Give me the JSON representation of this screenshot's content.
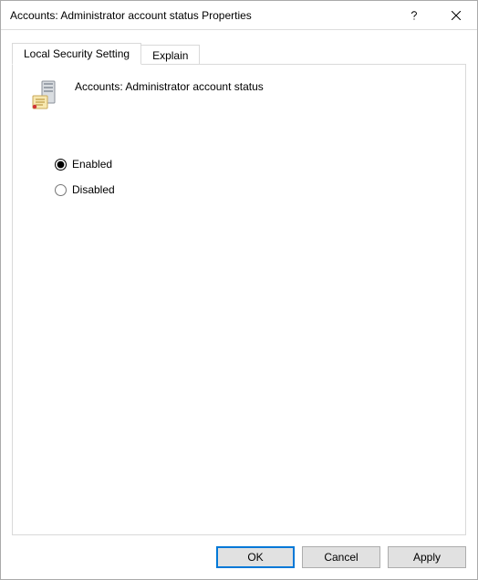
{
  "window": {
    "title": "Accounts: Administrator account status Properties"
  },
  "tabs": {
    "local_security": "Local Security Setting",
    "explain": "Explain"
  },
  "policy": {
    "name": "Accounts: Administrator account status"
  },
  "options": {
    "enabled": "Enabled",
    "disabled": "Disabled",
    "selected": "enabled"
  },
  "buttons": {
    "ok": "OK",
    "cancel": "Cancel",
    "apply": "Apply"
  }
}
